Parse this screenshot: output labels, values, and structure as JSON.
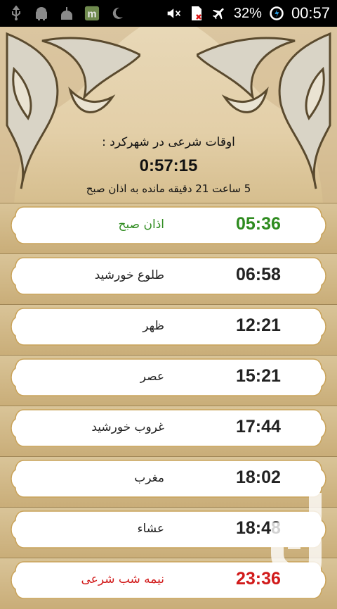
{
  "status_bar": {
    "battery_percent": "32%",
    "clock": "00:57",
    "icons_left": [
      "usb-icon",
      "android-icon",
      "mosque-icon",
      "m-app-icon",
      "crescent-icon"
    ],
    "icons_right": [
      "mute-icon",
      "no-sim-icon",
      "airplane-icon",
      "battery-icon"
    ]
  },
  "header": {
    "city_title": "اوقات شرعی در شهرکرد :",
    "current_time": "0:57:15",
    "countdown": "5 ساعت 21 دقیقه مانده به اذان صبح"
  },
  "prayer_times": [
    {
      "name": "اذان صبح",
      "time": "05:36",
      "color": "#2e8b1f"
    },
    {
      "name": "طلوع خورشید",
      "time": "06:58",
      "color": "#222222"
    },
    {
      "name": "ظهر",
      "time": "12:21",
      "color": "#222222"
    },
    {
      "name": "عصر",
      "time": "15:21",
      "color": "#222222"
    },
    {
      "name": "غروب خورشید",
      "time": "17:44",
      "color": "#222222"
    },
    {
      "name": "مغرب",
      "time": "18:02",
      "color": "#222222"
    },
    {
      "name": "عشاء",
      "time": "18:48",
      "color": "#222222"
    },
    {
      "name": "نیمه شب شرعی",
      "time": "23:36",
      "color": "#d11a1a"
    }
  ],
  "theme": {
    "background": "#c8ac7a",
    "card": "#ffffff",
    "card_border": "#c9a35a"
  }
}
